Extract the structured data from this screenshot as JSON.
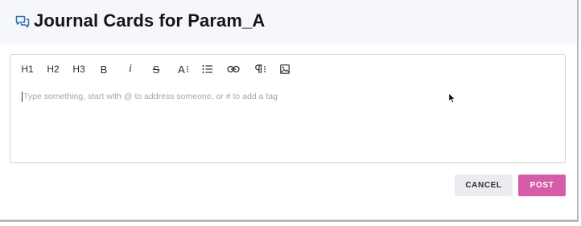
{
  "header": {
    "title": "Journal Cards for Param_A",
    "icon": "chat-bubbles-icon"
  },
  "toolbar": {
    "h1_label": "H1",
    "h2_label": "H2",
    "h3_label": "H3",
    "bold_label": "B",
    "italic_label": "i",
    "strike_label": "S",
    "font_size_label": "A",
    "icons": [
      "list-icon",
      "link-icon",
      "paragraph-icon",
      "image-icon"
    ]
  },
  "editor": {
    "placeholder": "Type something, start with @ to address someone, or # to add a tag"
  },
  "actions": {
    "cancel_label": "CANCEL",
    "post_label": "POST"
  },
  "colors": {
    "accent": "#d65ca9",
    "header_bg": "#f6f7fb",
    "icon_blue": "#2d6fb3"
  }
}
